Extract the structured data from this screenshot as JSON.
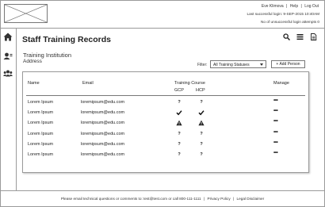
{
  "header": {
    "user_name": "Eve Klimova",
    "help_label": "Help",
    "logout_label": "Log Out",
    "separator": "|",
    "last_login": "Last successful login: 9-SEP-2015 10:40AM",
    "unsuccessful_attempts": "No of unsuccessful login attempts 0"
  },
  "nav": {
    "icons": [
      "home-icon",
      "user-card-icon",
      "group-icon"
    ]
  },
  "page": {
    "title": "Staff Training Records",
    "institution": "Training Institution",
    "address": "Address",
    "toolbar_icons": [
      "search-icon",
      "list-icon",
      "document-icon"
    ]
  },
  "filter": {
    "label": "Filter:",
    "selected": "All Training Statuses"
  },
  "add_person_label": "+ Add Person",
  "table": {
    "headers": {
      "name": "Name",
      "email": "Email",
      "training_course": "Training Course",
      "gcp": "GCP",
      "hcp": "HCP",
      "manage": "Manage"
    },
    "rows": [
      {
        "name": "Lorem Ipsum",
        "email": "loremipsum@edu.com",
        "gcp": "?",
        "hcp": "?",
        "manage": "•••"
      },
      {
        "name": "Lorem Ipsum",
        "email": "loremipsum@edu.com",
        "gcp": "check",
        "hcp": "check",
        "manage": "•••"
      },
      {
        "name": "Lorem Ipsum",
        "email": "loremipsum@edu.com",
        "gcp": "warning",
        "hcp": "warning",
        "manage": "•••"
      },
      {
        "name": "Lorem Ipsum",
        "email": "loremipsum@edu.com",
        "gcp": "?",
        "hcp": "?",
        "manage": "•••"
      },
      {
        "name": "Lorem Ipsum",
        "email": "loremipsum@edu.com",
        "gcp": "?",
        "hcp": "?",
        "manage": "•••"
      },
      {
        "name": "Lorem Ipsum",
        "email": "loremipsum@edu.com",
        "gcp": "?",
        "hcp": "?",
        "manage": "•••"
      }
    ]
  },
  "footer": {
    "contact": "Please email technical questions or comments to: test@test.com  or call 800-111-1111",
    "privacy": "Privacy Policy",
    "disclaimer": "Legal Disclaimer",
    "separator": "|"
  }
}
